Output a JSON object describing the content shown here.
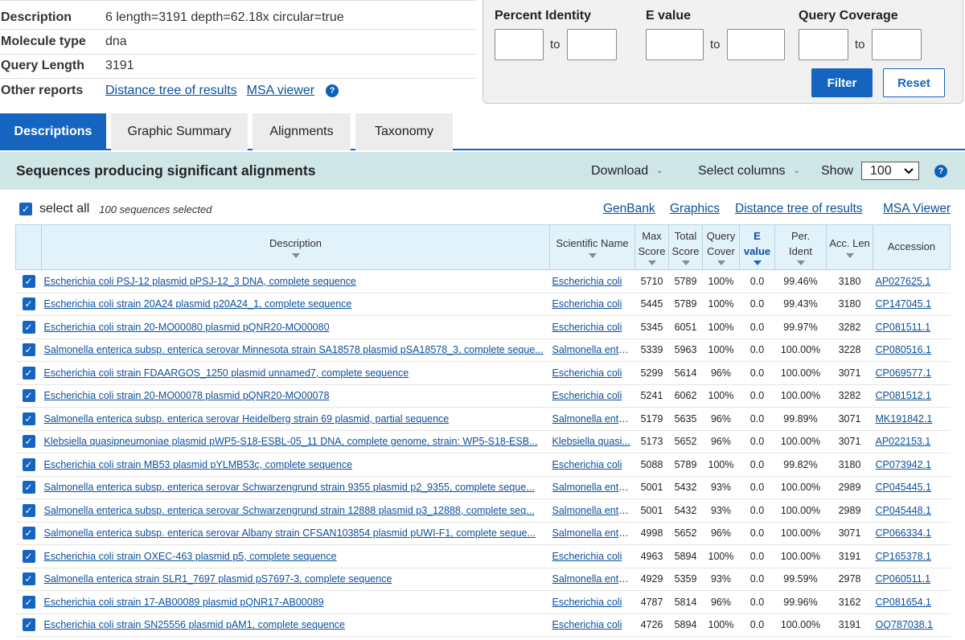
{
  "info": {
    "rows": [
      {
        "label": "Description",
        "value": "6 length=3191 depth=62.18x circular=true"
      },
      {
        "label": "Molecule type",
        "value": "dna"
      },
      {
        "label": "Query Length",
        "value": "3191"
      },
      {
        "label": "Other reports",
        "links": [
          "Distance tree of results",
          "MSA viewer"
        ]
      }
    ]
  },
  "filter": {
    "percent_identity": "Percent Identity",
    "e_value": "E value",
    "query_coverage": "Query Coverage",
    "to": "to",
    "filter_btn": "Filter",
    "reset_btn": "Reset"
  },
  "tabs": [
    "Descriptions",
    "Graphic Summary",
    "Alignments",
    "Taxonomy"
  ],
  "results_bar": {
    "title": "Sequences producing significant alignments",
    "download": "Download",
    "select_columns": "Select columns",
    "show": "Show",
    "show_value": "100"
  },
  "select_row": {
    "select_all": "select all",
    "selected_count": "100 sequences selected",
    "links": [
      "GenBank",
      "Graphics",
      "Distance tree of results",
      "MSA Viewer"
    ]
  },
  "table": {
    "headers": {
      "description": "Description",
      "scientific_name": "Scientific Name",
      "max_score": [
        "Max",
        "Score"
      ],
      "total_score": [
        "Total",
        "Score"
      ],
      "query_cover": [
        "Query",
        "Cover"
      ],
      "e_value": [
        "E",
        "value"
      ],
      "per_ident": [
        "Per.",
        "Ident"
      ],
      "acc_len": "Acc. Len",
      "accession": "Accession"
    },
    "rows": [
      {
        "description": "Escherichia coli PSJ-12 plasmid pPSJ-12_3 DNA, complete sequence",
        "sci": "Escherichia coli",
        "max": "5710",
        "total": "5789",
        "cover": "100%",
        "e": "0.0",
        "ident": "99.46%",
        "len": "3180",
        "acc": "AP027625.1"
      },
      {
        "description": "Escherichia coli strain 20A24 plasmid p20A24_1, complete sequence",
        "sci": "Escherichia coli",
        "max": "5445",
        "total": "5789",
        "cover": "100%",
        "e": "0.0",
        "ident": "99.43%",
        "len": "3180",
        "acc": "CP147045.1"
      },
      {
        "description": "Escherichia coli strain 20-MO00080 plasmid pQNR20-MO00080",
        "sci": "Escherichia coli",
        "max": "5345",
        "total": "6051",
        "cover": "100%",
        "e": "0.0",
        "ident": "99.97%",
        "len": "3282",
        "acc": "CP081511.1"
      },
      {
        "description": "Salmonella enterica subsp. enterica serovar Minnesota strain SA18578 plasmid pSA18578_3, complete seque...",
        "sci": "Salmonella ente...",
        "max": "5339",
        "total": "5963",
        "cover": "100%",
        "e": "0.0",
        "ident": "100.00%",
        "len": "3228",
        "acc": "CP080516.1"
      },
      {
        "description": "Escherichia coli strain FDAARGOS_1250 plasmid unnamed7, complete sequence",
        "sci": "Escherichia coli",
        "max": "5299",
        "total": "5614",
        "cover": "96%",
        "e": "0.0",
        "ident": "100.00%",
        "len": "3071",
        "acc": "CP069577.1"
      },
      {
        "description": "Escherichia coli strain 20-MO00078 plasmid pQNR20-MO00078",
        "sci": "Escherichia coli",
        "max": "5241",
        "total": "6062",
        "cover": "100%",
        "e": "0.0",
        "ident": "100.00%",
        "len": "3282",
        "acc": "CP081512.1"
      },
      {
        "description": "Salmonella enterica subsp. enterica serovar Heidelberg strain 69 plasmid, partial sequence",
        "sci": "Salmonella ente...",
        "max": "5179",
        "total": "5635",
        "cover": "96%",
        "e": "0.0",
        "ident": "99.89%",
        "len": "3071",
        "acc": "MK191842.1"
      },
      {
        "description": "Klebsiella quasipneumoniae plasmid pWP5-S18-ESBL-05_11 DNA, complete genome, strain: WP5-S18-ESB...",
        "sci": "Klebsiella quasi...",
        "max": "5173",
        "total": "5652",
        "cover": "96%",
        "e": "0.0",
        "ident": "100.00%",
        "len": "3071",
        "acc": "AP022153.1"
      },
      {
        "description": "Escherichia coli strain MB53 plasmid pYLMB53c, complete sequence",
        "sci": "Escherichia coli",
        "max": "5088",
        "total": "5789",
        "cover": "100%",
        "e": "0.0",
        "ident": "99.82%",
        "len": "3180",
        "acc": "CP073942.1"
      },
      {
        "description": "Salmonella enterica subsp. enterica serovar Schwarzengrund strain 9355 plasmid p2_9355, complete seque...",
        "sci": "Salmonella ente...",
        "max": "5001",
        "total": "5432",
        "cover": "93%",
        "e": "0.0",
        "ident": "100.00%",
        "len": "2989",
        "acc": "CP045445.1"
      },
      {
        "description": "Salmonella enterica subsp. enterica serovar Schwarzengrund strain 12888 plasmid p3_12888, complete seq...",
        "sci": "Salmonella ente...",
        "max": "5001",
        "total": "5432",
        "cover": "93%",
        "e": "0.0",
        "ident": "100.00%",
        "len": "2989",
        "acc": "CP045448.1"
      },
      {
        "description": "Salmonella enterica subsp. enterica serovar Albany strain CFSAN103854 plasmid pUWI-F1, complete seque...",
        "sci": "Salmonella ente...",
        "max": "4998",
        "total": "5652",
        "cover": "96%",
        "e": "0.0",
        "ident": "100.00%",
        "len": "3071",
        "acc": "CP066334.1"
      },
      {
        "description": "Escherichia coli strain OXEC-463 plasmid p5, complete sequence",
        "sci": "Escherichia coli",
        "max": "4963",
        "total": "5894",
        "cover": "100%",
        "e": "0.0",
        "ident": "100.00%",
        "len": "3191",
        "acc": "CP165378.1"
      },
      {
        "description": "Salmonella enterica strain SLR1_7697 plasmid pS7697-3, complete sequence",
        "sci": "Salmonella ente...",
        "max": "4929",
        "total": "5359",
        "cover": "93%",
        "e": "0.0",
        "ident": "99.59%",
        "len": "2978",
        "acc": "CP060511.1"
      },
      {
        "description": "Escherichia coli strain 17-AB00089 plasmid pQNR17-AB00089",
        "sci": "Escherichia coli",
        "max": "4787",
        "total": "5814",
        "cover": "96%",
        "e": "0.0",
        "ident": "99.96%",
        "len": "3162",
        "acc": "CP081654.1"
      },
      {
        "description": "Escherichia coli strain SN25556 plasmid pAM1, complete sequence",
        "sci": "Escherichia coli",
        "max": "4726",
        "total": "5894",
        "cover": "100%",
        "e": "0.0",
        "ident": "100.00%",
        "len": "3191",
        "acc": "OQ787038.1"
      }
    ]
  }
}
